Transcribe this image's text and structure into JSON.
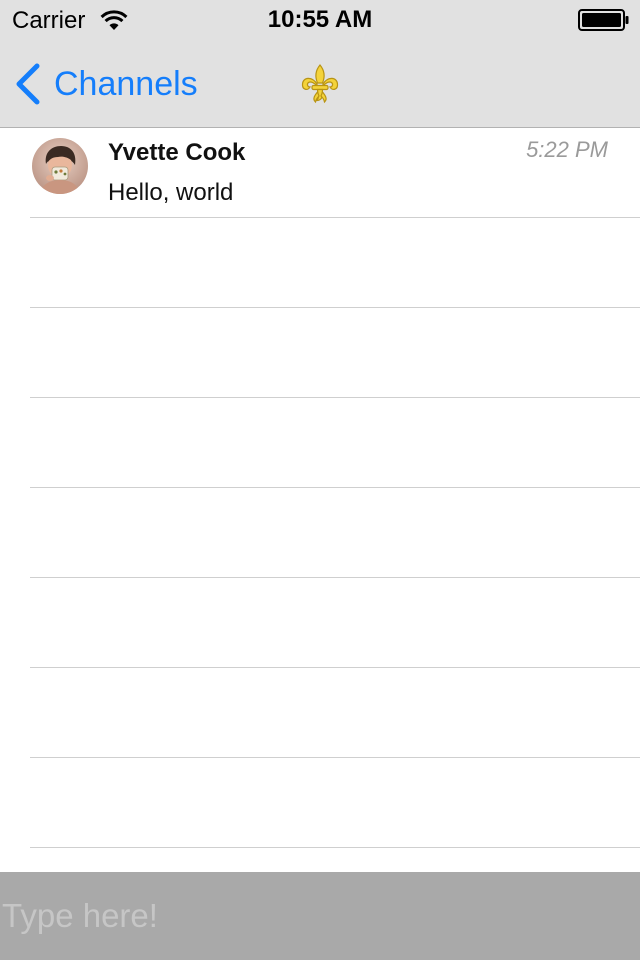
{
  "status_bar": {
    "carrier": "Carrier",
    "time": "10:55 AM",
    "wifi_icon": "wifi-icon",
    "battery_icon": "battery-full-icon"
  },
  "nav": {
    "back_label": "Channels",
    "back_icon": "chevron-left-icon",
    "title_icon": "fleur-de-lis-icon",
    "accent_color": "#157efb"
  },
  "messages": [
    {
      "sender": "Yvette Cook",
      "time": "5:22 PM",
      "text": "Hello, world",
      "avatar_icon": "user-avatar"
    }
  ],
  "input": {
    "placeholder": "Type here!",
    "value": ""
  },
  "colors": {
    "nav_background": "#e1e1e1",
    "input_bar_background": "#a9a9a9",
    "timestamp": "#9a9a9a",
    "separator": "#cfcfcf"
  }
}
